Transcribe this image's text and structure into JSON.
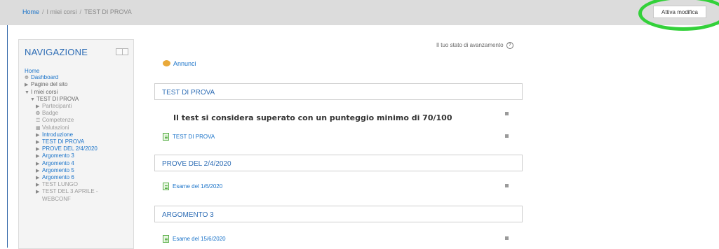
{
  "breadcrumb": {
    "home": "Home",
    "my_courses": "I miei corsi",
    "current": "TEST DI PROVA",
    "separator": "/"
  },
  "toolbar": {
    "edit_button_label": "Attiva modifica"
  },
  "navigation": {
    "title": "NAVIGAZIONE",
    "items": [
      {
        "label": "Home",
        "marker": ""
      },
      {
        "label": "Dashboard",
        "marker": "❁"
      },
      {
        "label": "Pagine del sito",
        "marker": "▶"
      },
      {
        "label": "I miei corsi",
        "marker": "▼"
      },
      {
        "label": "TEST DI PROVA",
        "marker": "▼"
      },
      {
        "label": "Partecipanti",
        "marker": "▶"
      },
      {
        "label": "Badge",
        "marker": "❂"
      },
      {
        "label": "Competenze",
        "marker": "☲"
      },
      {
        "label": "Valutazioni",
        "marker": "▦"
      },
      {
        "label": "Introduzione",
        "marker": "▶"
      },
      {
        "label": "TEST DI PROVA",
        "marker": "▶"
      },
      {
        "label": "PROVE DEL 2/4/2020",
        "marker": "▶"
      },
      {
        "label": "Argomento 3",
        "marker": "▶"
      },
      {
        "label": "Argomento 4",
        "marker": "▶"
      },
      {
        "label": "Argomento 5",
        "marker": "▶"
      },
      {
        "label": "Argomento 6",
        "marker": "▶"
      },
      {
        "label": "TEST LUNGO",
        "marker": "▶"
      },
      {
        "label": "TEST DEL 3 APRILE -",
        "marker": "▶"
      },
      {
        "label": "WEBCONF",
        "marker": ""
      }
    ]
  },
  "main": {
    "progress_label": "Il tuo stato di avanzamento",
    "progress_help": "?",
    "announcements": "Annunci",
    "sections": [
      {
        "title": "TEST DI PROVA"
      },
      {
        "title": "PROVE DEL 2/4/2020"
      },
      {
        "title": "ARGOMENTO 3"
      }
    ],
    "notice": "Il test si considera superato con un punteggio minimo di 70/100",
    "activities": [
      {
        "label": "TEST DI PROVA"
      },
      {
        "label": "Esame del 1/6/2020"
      },
      {
        "label": "Esame del 15/6/2020"
      }
    ]
  },
  "colors": {
    "accent": "#1a73c9",
    "highlight_ring": "#33d13a",
    "topbar": "#dcdcdc"
  }
}
